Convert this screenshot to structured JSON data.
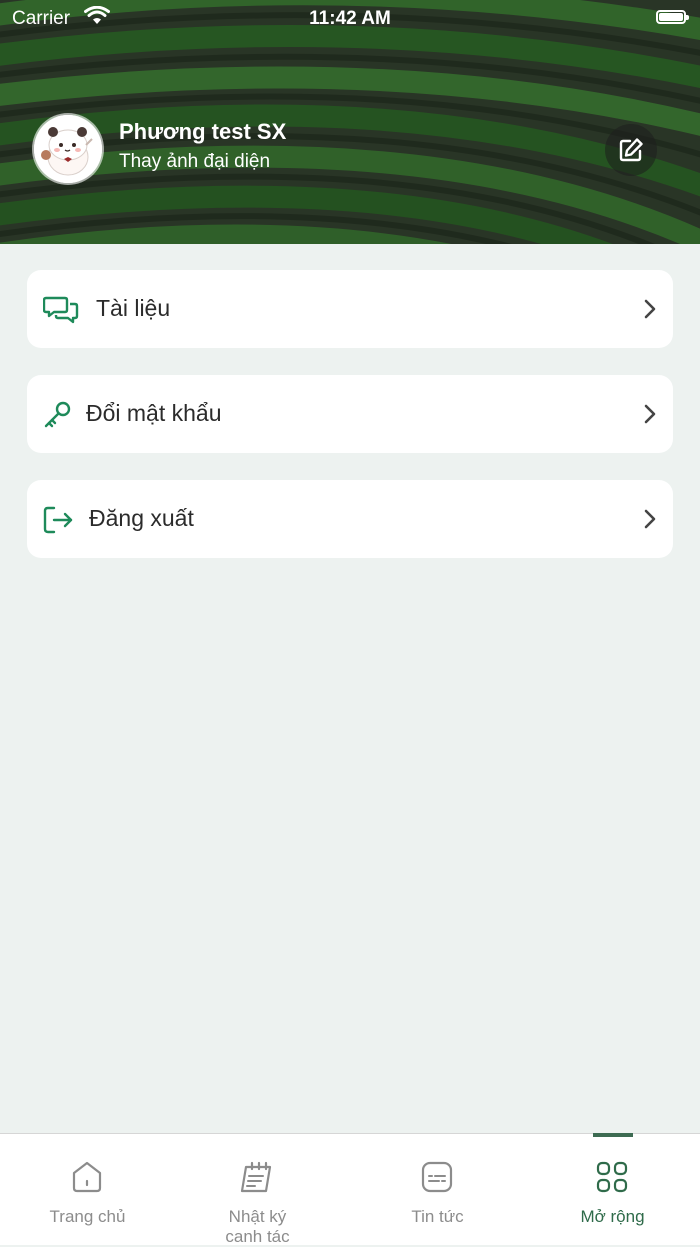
{
  "status_bar": {
    "carrier": "Carrier",
    "time": "11:42 AM"
  },
  "profile": {
    "name": "Phương test SX",
    "subtitle": "Thay ảnh đại diện",
    "avatar_icon": "panda-avatar",
    "edit_icon": "edit-icon"
  },
  "menu": {
    "items": [
      {
        "label": "Tài liệu",
        "icon": "chat-bubbles-icon"
      },
      {
        "label": "Đổi mật khẩu",
        "icon": "key-icon"
      },
      {
        "label": "Đăng xuất",
        "icon": "logout-icon"
      }
    ]
  },
  "tabbar": {
    "tabs": [
      {
        "label": "Trang chủ",
        "icon": "home-icon",
        "active": false
      },
      {
        "label": "Nhật ký canh tác",
        "label_line1": "Nhật ký",
        "label_line2": "canh tác",
        "icon": "notebook-icon",
        "active": false
      },
      {
        "label": "Tin tức",
        "icon": "news-icon",
        "active": false
      },
      {
        "label": "Mở rộng",
        "icon": "grid-icon",
        "active": true
      }
    ]
  },
  "colors": {
    "accent": "#1e8a5a",
    "tab_active": "#2f6b4a",
    "tab_inactive": "#8c8c8c",
    "background": "#edf2f0"
  }
}
